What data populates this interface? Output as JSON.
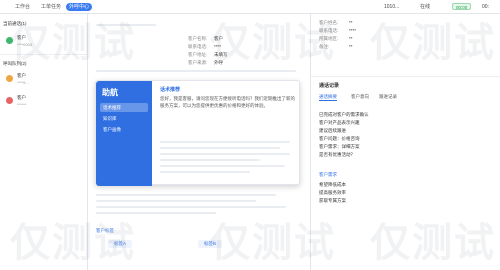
{
  "topbar": {
    "tabs": [
      "工作台",
      "工单任务",
      "外呼中心"
    ],
    "active_tab": 2,
    "right_id": "1010...",
    "right_status": "在线",
    "right_badge": "00:00",
    "right_extra": "00:"
  },
  "left": {
    "sec1": "当前通话(1)",
    "sec2": "呼叫队列(2)",
    "cards": [
      {
        "name": "客户",
        "sub": "****0004"
      },
      {
        "name": "客户",
        "sub": "****5..."
      },
      {
        "name": "客户",
        "sub": "******"
      }
    ]
  },
  "middle": {
    "info": [
      {
        "label": "客户名称:",
        "value": "客户"
      },
      {
        "label": "联系电话:",
        "value": "****"
      },
      {
        "label": "客户地址:",
        "value": "未填写"
      },
      {
        "label": "客户来源:",
        "value": "外呼"
      }
    ],
    "bottom_label": "客户标签",
    "bottom_btns": [
      "标签A",
      "标签B"
    ]
  },
  "popup": {
    "brand": "助航",
    "menu": [
      "话术推荐",
      "知识库",
      "客户画像"
    ],
    "header": "话术推荐",
    "paragraph": "您好，我是客服，请问您现在方便接听电话吗？我们近期推出了新的服务方案，可以为您提供更优惠的价格和更好的体验。"
  },
  "right": {
    "fields": [
      {
        "label": "客户姓名:",
        "value": "**"
      },
      {
        "label": "联系电话:",
        "value": "****"
      },
      {
        "label": "所属地区:",
        "value": "**"
      },
      {
        "label": "备注:",
        "value": "**"
      }
    ],
    "section_title": "通话记录",
    "tabs": [
      "通话摘要",
      "客户意向",
      "跟进记录"
    ],
    "lines": [
      "已完成对客户的需求确认",
      "客户对产品表示兴趣",
      "建议后续跟进",
      "客户问题：价格咨询",
      "客户需求：详细方案",
      "是否有优惠活动？"
    ],
    "sub_title": "客户需求",
    "sub_lines": [
      "希望降低成本",
      "提高服务效率",
      "获取专属方案"
    ]
  },
  "watermark": "仅测试",
  "colors": {
    "accent": "#2f6fe2",
    "online": "#1fa34a"
  }
}
